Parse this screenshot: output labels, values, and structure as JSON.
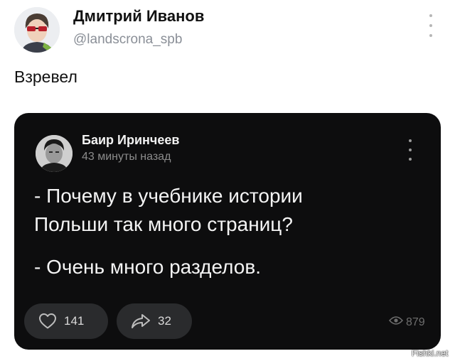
{
  "tweet": {
    "author_name": "Дмитрий Иванов",
    "author_handle": "@landscrona_spb",
    "text": "Взревел"
  },
  "embedded_post": {
    "author_name": "Баир Иринчеев",
    "timestamp": "43 минуты назад",
    "lines": [
      "- Почему в учебнике истории",
      "Польши так много страниц?",
      "- Очень много разделов."
    ],
    "likes": "141",
    "reposts": "32",
    "views": "879"
  },
  "watermark": "Fishki.net",
  "icons": {
    "menu": "vertical-dots-icon",
    "like": "heart-icon",
    "repost": "share-arrow-icon",
    "views": "eye-icon"
  },
  "colors": {
    "card_bg": "#0d0d0e",
    "pill_bg": "#2a2b2d",
    "handle": "#8a8f97"
  }
}
